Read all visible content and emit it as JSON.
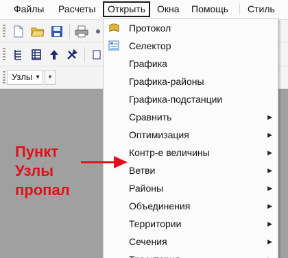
{
  "menubar": {
    "items": [
      "Файлы",
      "Расчеты",
      "Открыть",
      "Окна",
      "Помощь",
      "Стиль"
    ],
    "active": "Открыть"
  },
  "toolbar": {
    "nodes_combo": "Узлы"
  },
  "open_menu": {
    "items": [
      {
        "label": "Протокол",
        "icon": "protocol-icon",
        "submenu": false
      },
      {
        "label": "Селектор",
        "icon": "selector-icon",
        "submenu": false
      },
      {
        "label": "Графика",
        "submenu": false
      },
      {
        "label": "Графика-районы",
        "submenu": false
      },
      {
        "label": "Графика-подстанции",
        "submenu": false
      },
      {
        "label": "Сравнить",
        "submenu": true
      },
      {
        "label": "Оптимизация",
        "submenu": true
      },
      {
        "label": "Контр-е величины",
        "submenu": true
      },
      {
        "label": "Ветви",
        "submenu": true
      },
      {
        "label": "Районы",
        "submenu": true
      },
      {
        "label": "Объединения",
        "submenu": true
      },
      {
        "label": "Территории",
        "submenu": true
      },
      {
        "label": "Сечения",
        "submenu": true
      },
      {
        "label": "Траектория",
        "submenu": true
      }
    ]
  },
  "annotation": {
    "lines": [
      "Пункт",
      "Узлы",
      "пропал"
    ],
    "color": "#e0101a"
  },
  "colors": {
    "menu_bg": "#fbfbfb",
    "workspace": "#a0a0a0",
    "annotation_red": "#e0101a"
  }
}
